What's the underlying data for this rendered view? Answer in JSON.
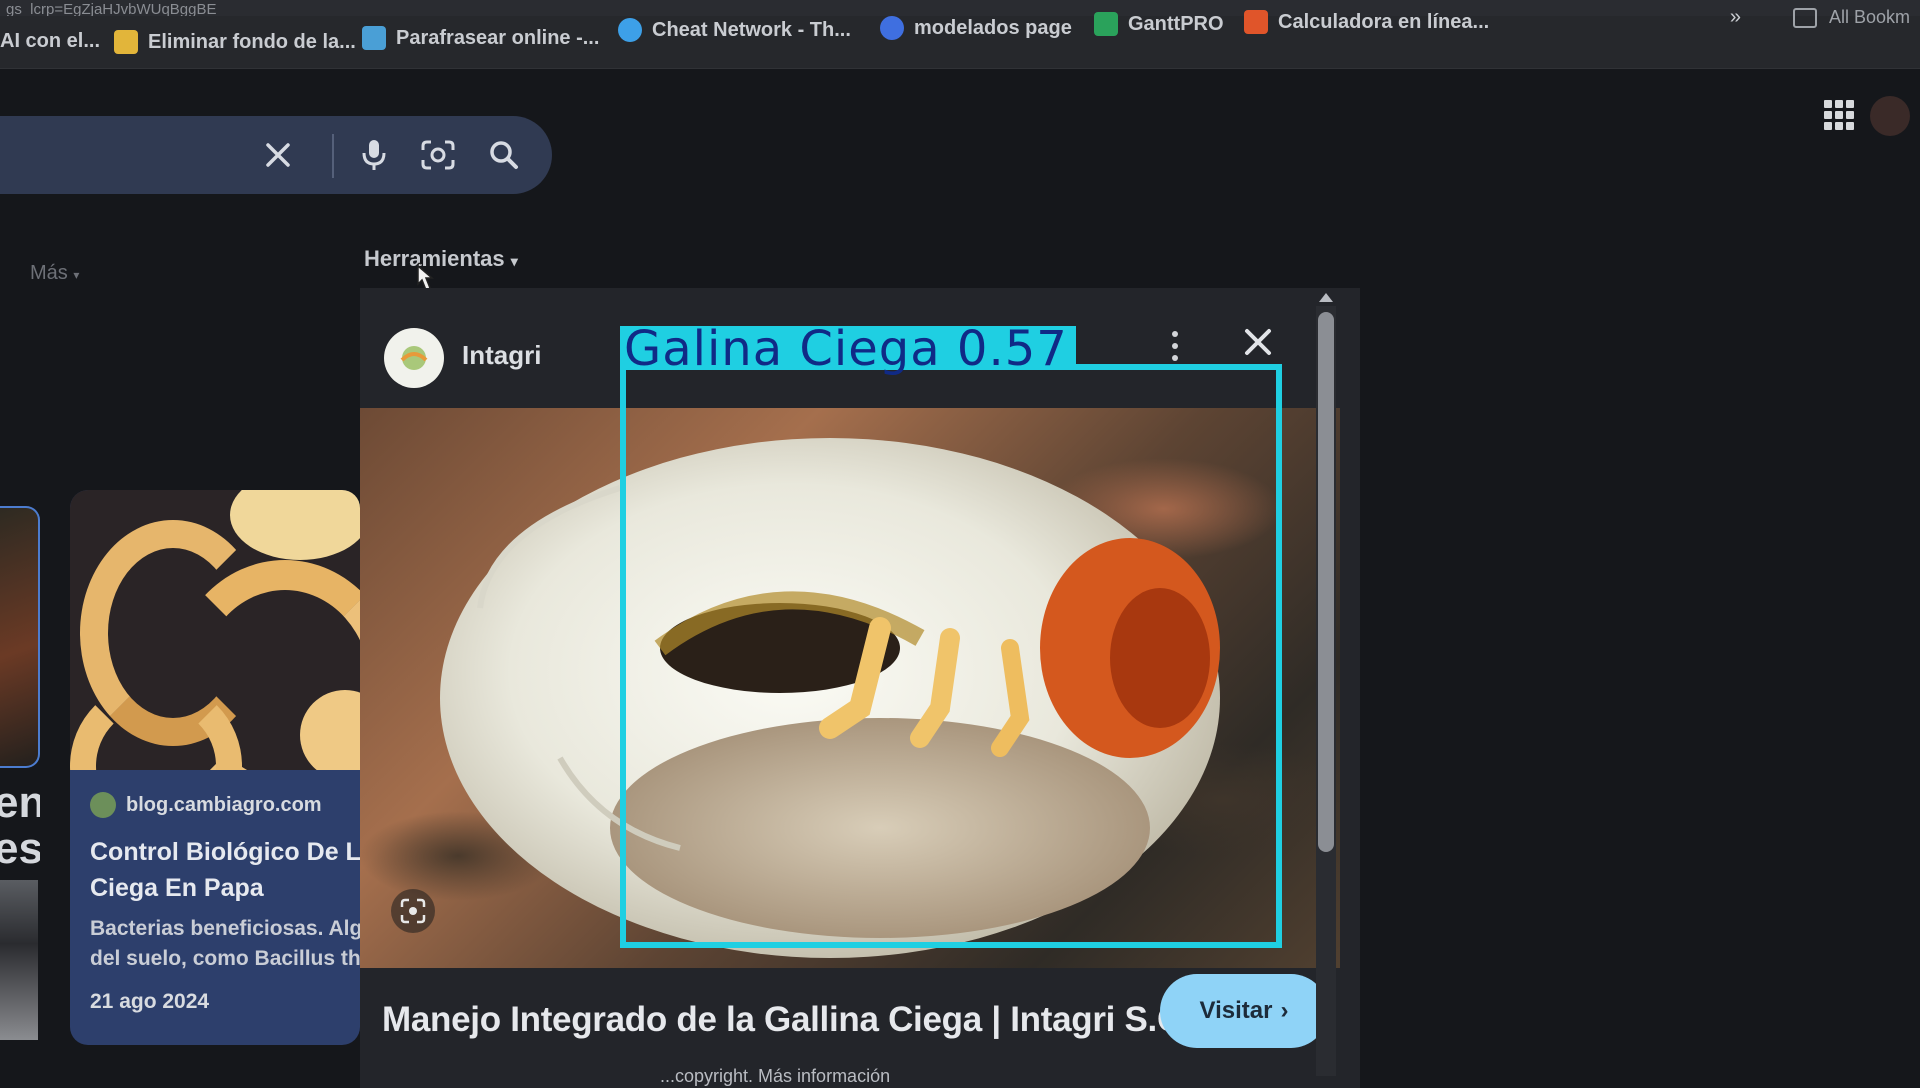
{
  "browser": {
    "url_fragment": "gs_lcrp=EgZjaHJvbWUqBggBE",
    "bookmarks": [
      {
        "label": "AI con el...",
        "color": "#c97a2a"
      },
      {
        "label": "Eliminar fondo de la...",
        "color": "#e2b53a"
      },
      {
        "label": "Parafrasear online -...",
        "color": "#4a9fd6"
      },
      {
        "label": "Cheat Network - Th...",
        "color": "#3da0e8"
      },
      {
        "label": "modelados page",
        "color": "#3f6fe0"
      },
      {
        "label": "GanttPRO",
        "color": "#2aa25b"
      },
      {
        "label": "Calculadora en línea...",
        "color": "#e0552a"
      }
    ],
    "all_bookmarks_label": "All Bookm"
  },
  "search": {
    "clear_icon": "close-icon",
    "mic_icon": "mic-icon",
    "lens_icon": "camera-lens-icon",
    "search_icon": "search-icon"
  },
  "filters": {
    "more_label": "Más",
    "tools_label": "Herramientas"
  },
  "left_card": {
    "source": "blog.cambiagro.com",
    "title_line1": "Control Biológico De La G",
    "title_line2": "Ciega En Papa",
    "desc_line1": "Bacterias beneficiosas. Algun",
    "desc_line2": "del suelo, como Bacillus thur",
    "date": "21 ago 2024",
    "strip_text": "en\nes"
  },
  "preview": {
    "source_name": "Intagri",
    "title": "Manejo Integrado de la Gallina Ciega | Intagri S.C.",
    "visit_label": "Visitar",
    "subtitle": "...copyright. Más información"
  },
  "detection": {
    "label": "Galina Ciega",
    "confidence": "0.57",
    "box_color": "#1fcfe2",
    "text_color": "#102a86"
  }
}
